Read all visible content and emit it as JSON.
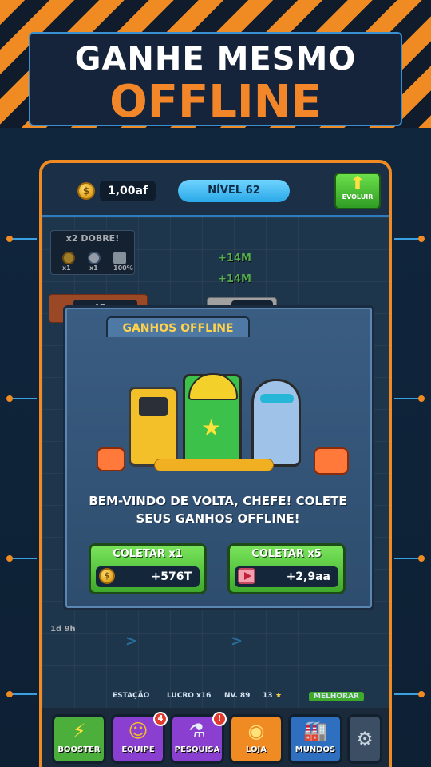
{
  "hero": {
    "line1": "GANHE MESMO",
    "line2": "OFFLINE"
  },
  "topbar": {
    "currency": "1,00af",
    "level": "NÍVEL 62",
    "evolve_label": "EVOLUIR"
  },
  "factory": {
    "boost_label": "x2 DOBRE!",
    "boost_icons": [
      "x1",
      "x1",
      "100%"
    ],
    "boost_icon_names": [
      "coin-icon",
      "clock-icon",
      "cart-icon"
    ],
    "left_station_value": "45aa",
    "center_station_value": "135M",
    "floating_gains": [
      "+14M",
      "+14M"
    ],
    "timer": "1d 9h"
  },
  "modal": {
    "title": "GANHOS OFFLINE",
    "message": "BEM-VINDO DE VOLTA, CHEFE! COLETE SEUS GANHOS OFFLINE!",
    "collect_x1": {
      "label": "COLETAR x1",
      "value": "+576T",
      "icon": "coin-icon"
    },
    "collect_x5": {
      "label": "COLETAR x5",
      "value": "+2,9aa",
      "icon": "video-ad-icon"
    }
  },
  "stats": {
    "station": "ESTAÇÃO",
    "profit": "LUCRO x16",
    "level": "NV. 89",
    "stars": "13",
    "upgrade": "MELHORAR"
  },
  "nav": [
    {
      "label": "BOOSTER",
      "icon": "lightning-icon",
      "color": "#4caf3c",
      "badge": ""
    },
    {
      "label": "EQUIPE",
      "icon": "robot-icon",
      "color": "#8a3fd1",
      "badge": "4"
    },
    {
      "label": "PESQUISA",
      "icon": "flask-icon",
      "color": "#8a3fd1",
      "badge": "!"
    },
    {
      "label": "LOJA",
      "icon": "coin-stack-icon",
      "color": "#f08a22",
      "badge": ""
    },
    {
      "label": "MUNDOS",
      "icon": "factory-icon",
      "color": "#2e6fc0",
      "badge": ""
    },
    {
      "label": "",
      "icon": "gear-icon",
      "color": "#3c4e63",
      "badge": ""
    }
  ],
  "colors": {
    "accent": "#f08a22",
    "primary_blue": "#2aa8e8",
    "green": "#3ea92b"
  }
}
